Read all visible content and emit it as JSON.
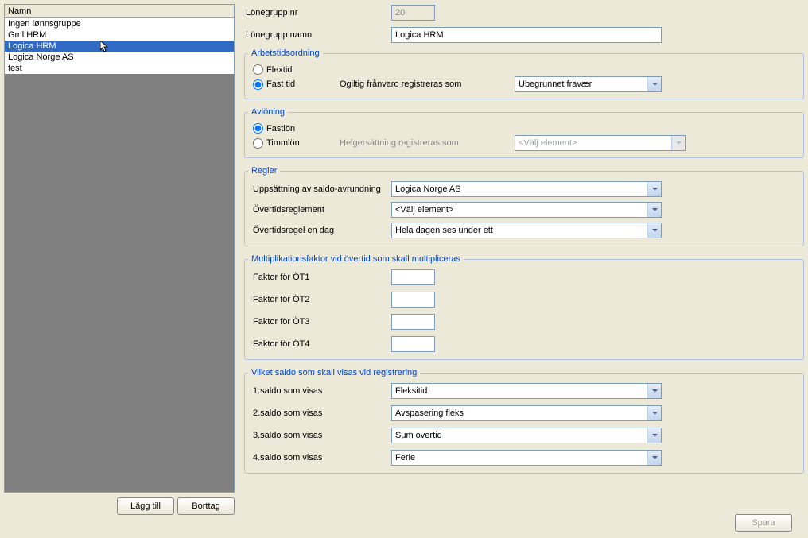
{
  "list": {
    "header": "Namn",
    "items": [
      "Ingen lønnsgruppe",
      "Gml HRM",
      "Logica HRM",
      "Logica Norge AS",
      "test"
    ],
    "selected_index": 2
  },
  "buttons": {
    "add": "Lägg till",
    "remove": "Borttag",
    "save": "Spara"
  },
  "top": {
    "group_nr_label": "Lönegrupp nr",
    "group_nr_value": "20",
    "group_name_label": "Lönegrupp namn",
    "group_name_value": "Logica HRM"
  },
  "arbetstid": {
    "legend": "Arbetstidsordning",
    "flextid": "Flextid",
    "fasttid": "Fast tid",
    "invalid_label": "Ogiltig frånvaro registreras som",
    "invalid_value": "Ubegrunnet fravær"
  },
  "avloning": {
    "legend": "Avlöning",
    "fastlon": "Fastlön",
    "timmlon": "Timmlön",
    "holiday_label": "Helgersättning registreras som",
    "holiday_value": "<Välj element>"
  },
  "regler": {
    "legend": "Regler",
    "saldo_label": "Uppsättning av saldo-avrundning",
    "saldo_value": "Logica Norge AS",
    "overtid_label": "Övertidsreglement",
    "overtid_value": "<Välj element>",
    "overtid_day_label": "Övertidsregel en dag",
    "overtid_day_value": "Hela dagen ses under ett"
  },
  "multi": {
    "legend": "Multiplikationsfaktor vid övertid som skall multipliceras",
    "f1": "Faktor för ÖT1",
    "f2": "Faktor för ÖT2",
    "f3": "Faktor för ÖT3",
    "f4": "Faktor för ÖT4"
  },
  "saldo": {
    "legend": "Vilket saldo som skall visas vid registrering",
    "l1": "1.saldo som visas",
    "l2": "2.saldo som visas",
    "l3": "3.saldo som visas",
    "l4": "4.saldo som visas",
    "v1": "Fleksitid",
    "v2": "Avspasering fleks",
    "v3": "Sum overtid",
    "v4": "Ferie"
  }
}
